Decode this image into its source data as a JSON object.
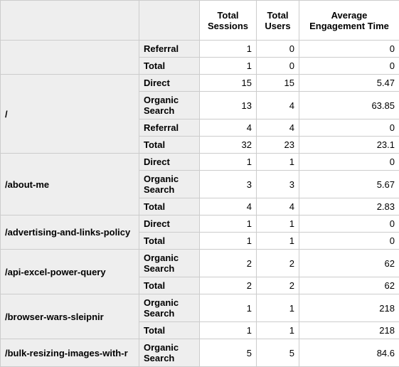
{
  "headers": {
    "path": "",
    "source": "",
    "sessions": "Total Sessions",
    "users": "Total Users",
    "engagement": "Average Engagement Time"
  },
  "groups": [
    {
      "path": "",
      "rows": [
        {
          "source": "Referral",
          "sessions": "1",
          "users": "0",
          "engagement": "0"
        },
        {
          "source": "Total",
          "sessions": "1",
          "users": "0",
          "engagement": "0"
        }
      ]
    },
    {
      "path": "/",
      "rows": [
        {
          "source": "Direct",
          "sessions": "15",
          "users": "15",
          "engagement": "5.47"
        },
        {
          "source": "Organic Search",
          "sessions": "13",
          "users": "4",
          "engagement": "63.85"
        },
        {
          "source": "Referral",
          "sessions": "4",
          "users": "4",
          "engagement": "0"
        },
        {
          "source": "Total",
          "sessions": "32",
          "users": "23",
          "engagement": "23.1"
        }
      ]
    },
    {
      "path": "/about-me",
      "rows": [
        {
          "source": "Direct",
          "sessions": "1",
          "users": "1",
          "engagement": "0"
        },
        {
          "source": "Organic Search",
          "sessions": "3",
          "users": "3",
          "engagement": "5.67"
        },
        {
          "source": "Total",
          "sessions": "4",
          "users": "4",
          "engagement": "2.83"
        }
      ]
    },
    {
      "path": "/advertising-and-links-policy",
      "rows": [
        {
          "source": "Direct",
          "sessions": "1",
          "users": "1",
          "engagement": "0"
        },
        {
          "source": "Total",
          "sessions": "1",
          "users": "1",
          "engagement": "0"
        }
      ]
    },
    {
      "path": "/api-excel-power-query",
      "rows": [
        {
          "source": "Organic Search",
          "sessions": "2",
          "users": "2",
          "engagement": "62"
        },
        {
          "source": "Total",
          "sessions": "2",
          "users": "2",
          "engagement": "62"
        }
      ]
    },
    {
      "path": "/browser-wars-sleipnir",
      "rows": [
        {
          "source": "Organic Search",
          "sessions": "1",
          "users": "1",
          "engagement": "218"
        },
        {
          "source": "Total",
          "sessions": "1",
          "users": "1",
          "engagement": "218"
        }
      ]
    },
    {
      "path": "/bulk-resizing-images-with-r",
      "rows": [
        {
          "source": "Organic Search",
          "sessions": "5",
          "users": "5",
          "engagement": "84.6"
        }
      ]
    }
  ]
}
